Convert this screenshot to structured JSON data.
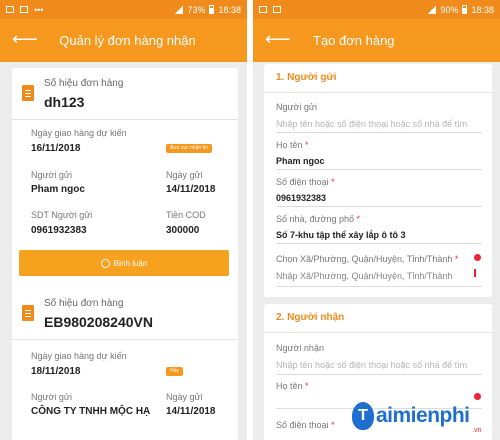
{
  "left": {
    "status": {
      "battery": "73%",
      "time": "18:38"
    },
    "appbar": {
      "title": "Quản lý đơn hàng nhận"
    },
    "orders": [
      {
        "tracking_label": "Số hiệu đơn hàng",
        "tracking_no": "dh123",
        "delivery_label": "Ngày giao hàng dự kiến",
        "delivery_date": "16/11/2018",
        "tag": "Bưu cục nhận tin",
        "sender_label": "Người gửi",
        "sender": "Pham ngoc",
        "date_label": "Ngày gửi",
        "date": "14/11/2018",
        "phone_label": "SDT Người gửi",
        "phone": "0961932383",
        "cod_label": "Tiền COD",
        "cod": "300000",
        "button": "Bình luận"
      },
      {
        "tracking_label": "Số hiệu đơn hàng",
        "tracking_no": "EB980208240VN",
        "delivery_label": "Ngày giao hàng dự kiến",
        "delivery_date": "18/11/2018",
        "tag": "Hủy",
        "sender_label": "Người gửi",
        "sender": "CÔNG TY TNHH MỘC HẠ",
        "date_label": "Ngày gửi",
        "date": "14/11/2018"
      }
    ]
  },
  "right": {
    "status": {
      "battery": "90%",
      "time": "18:38"
    },
    "appbar": {
      "title": "Tạo đơn hàng"
    },
    "sender_section": {
      "title": "1. Người gửi",
      "fields": {
        "sender_label": "Người gửi",
        "sender_placeholder": "Nhập tên hoặc số điện thoại hoặc số nhà để tìm",
        "name_label": "Họ tên",
        "name_value": "Pham ngoc",
        "phone_label": "Số điện thoại",
        "phone_value": "0961932383",
        "street_label": "Số nhà, đường phố",
        "street_value": "Số 7-khu tập thể xây lắp ô tô 3",
        "area_label": "Chọn Xã/Phường, Quận/Huyện, Tỉnh/Thành",
        "area_placeholder": "Nhập Xã/Phường, Quận/Huyện, Tỉnh/Thành"
      }
    },
    "receiver_section": {
      "title": "2. Người nhận",
      "fields": {
        "receiver_label": "Người nhận",
        "receiver_placeholder": "Nhập tên hoặc số điện thoại hoặc số nhà để tìm",
        "name_label": "Họ tên",
        "phone_label": "Số điện thoại"
      }
    },
    "required_mark": "*"
  },
  "watermark": {
    "logo_letter": "T",
    "text": "aimienphi",
    "suffix": ".vn"
  },
  "colors": {
    "primary": "#f6981e",
    "status_bar": "#f08a1b",
    "error": "#e22233",
    "watermark": "#1f6fd0"
  }
}
